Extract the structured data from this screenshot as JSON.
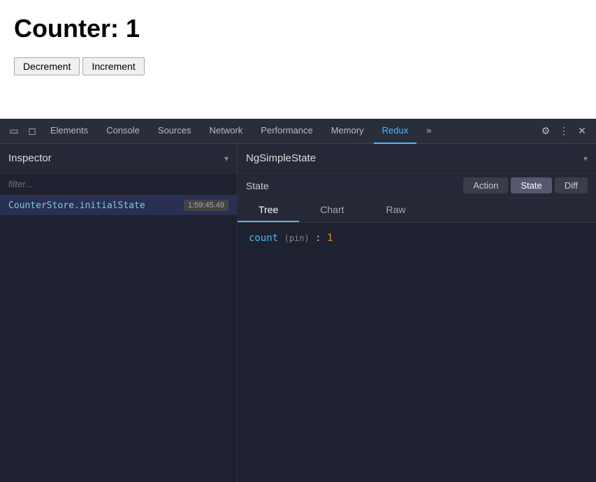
{
  "page": {
    "counter_title": "Counter: 1",
    "decrement_label": "Decrement",
    "increment_label": "Increment"
  },
  "devtools": {
    "tabs": [
      {
        "label": "Elements",
        "active": false
      },
      {
        "label": "Console",
        "active": false
      },
      {
        "label": "Sources",
        "active": false
      },
      {
        "label": "Network",
        "active": false
      },
      {
        "label": "Performance",
        "active": false
      },
      {
        "label": "Memory",
        "active": false
      },
      {
        "label": "Redux",
        "active": true
      }
    ],
    "more_tabs_icon": "»",
    "gear_icon": "⚙",
    "more_icon": "⋮",
    "close_icon": "✕",
    "inspector_label": "Inspector",
    "inspector_arrow": "▾",
    "ng_simple_state_label": "NgSimpleState",
    "ng_simple_state_arrow": "▾",
    "filter_placeholder": "filter...",
    "list_items": [
      {
        "name": "CounterStore.initialState",
        "time": "1:59:45.49",
        "active": true
      }
    ],
    "state_label": "State",
    "action_btn": "Action",
    "state_btn": "State",
    "diff_btn": "Diff",
    "view_tabs": [
      {
        "label": "Tree",
        "active": true
      },
      {
        "label": "Chart",
        "active": false
      },
      {
        "label": "Raw",
        "active": false
      }
    ],
    "state_content": {
      "key": "count",
      "pin_label": "(pin)",
      "colon": ":",
      "value": "1"
    }
  }
}
